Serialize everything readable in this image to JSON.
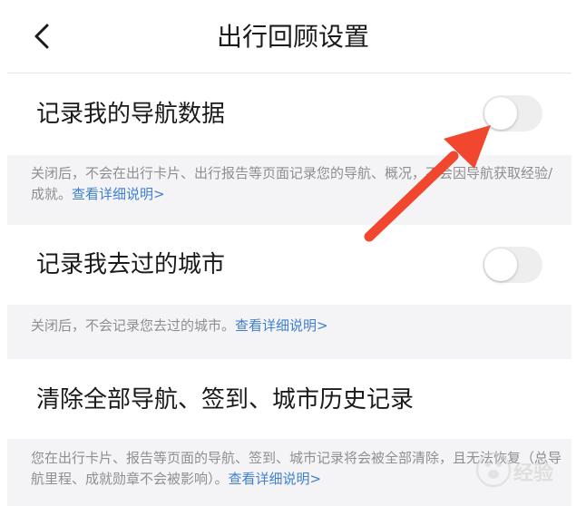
{
  "header": {
    "title": "出行回顾设置",
    "back_icon": "chevron-left-icon"
  },
  "settings": [
    {
      "label": "记录我的导航数据",
      "toggle_on": false,
      "note_text": "关闭后，不会在出行卡片、出行报告等页面记录您的导航、概况，不会因导航获取经验/成就。",
      "note_link": "查看详细说明>"
    },
    {
      "label": "记录我去过的城市",
      "toggle_on": false,
      "note_text": "关闭后，不会记录您去过的城市。",
      "note_link": "查看详细说明>"
    },
    {
      "label": "清除全部导航、签到、城市历史记录",
      "note_text": "您在出行卡片、报告等页面的导航、签到、城市记录将会被全部清除，且无法恢复（总导航里程、成就勋章不会被影响）。",
      "note_link": "查看详细说明>"
    }
  ],
  "annotation": {
    "arrow_color": "#f0472e"
  },
  "watermark": {
    "text": "经验"
  },
  "colors": {
    "link": "#3f7fd0",
    "note_bg": "#f4f4f6",
    "toggle_off": "#eeeeee"
  }
}
